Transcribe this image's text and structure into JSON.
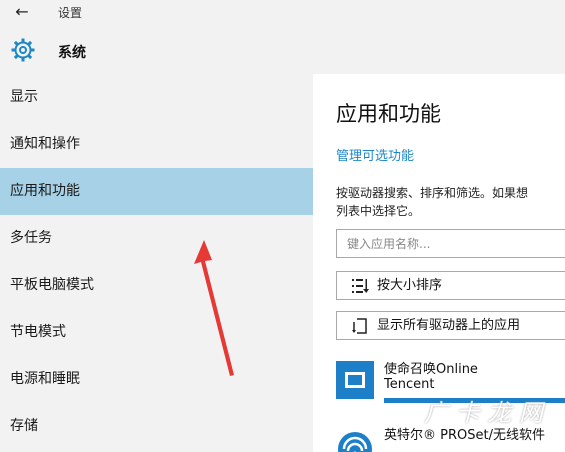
{
  "window": {
    "title": "设置",
    "heading": "系统"
  },
  "icons": {
    "back": "back-arrow-icon",
    "app": "gear-icon"
  },
  "sidebar": {
    "items": [
      {
        "label": "显示"
      },
      {
        "label": "通知和操作"
      },
      {
        "label": "应用和功能",
        "active": true
      },
      {
        "label": "多任务"
      },
      {
        "label": "平板电脑模式"
      },
      {
        "label": "节电模式"
      },
      {
        "label": "电源和睡眠"
      },
      {
        "label": "存储"
      }
    ]
  },
  "main": {
    "title": "应用和功能",
    "manage_link": "管理可选功能",
    "description_line1": "按驱动器搜索、排序和筛选。如果想",
    "description_line2": "列表中选择它。",
    "search_placeholder": "键入应用名称...",
    "sort_button": "按大小排序",
    "drive_button": "显示所有驱动器上的应用",
    "apps": [
      {
        "name": "使命召唤Online",
        "publisher": "Tencent"
      },
      {
        "name": "英特尔® PROSet/无线软件"
      }
    ]
  },
  "watermark": "广 卡 龙 网",
  "colors": {
    "accent": "#1e88c7",
    "selected": "#a6d1e6",
    "sidebar_bg": "#f2f2f2",
    "annotation_arrow": "#e53935"
  }
}
